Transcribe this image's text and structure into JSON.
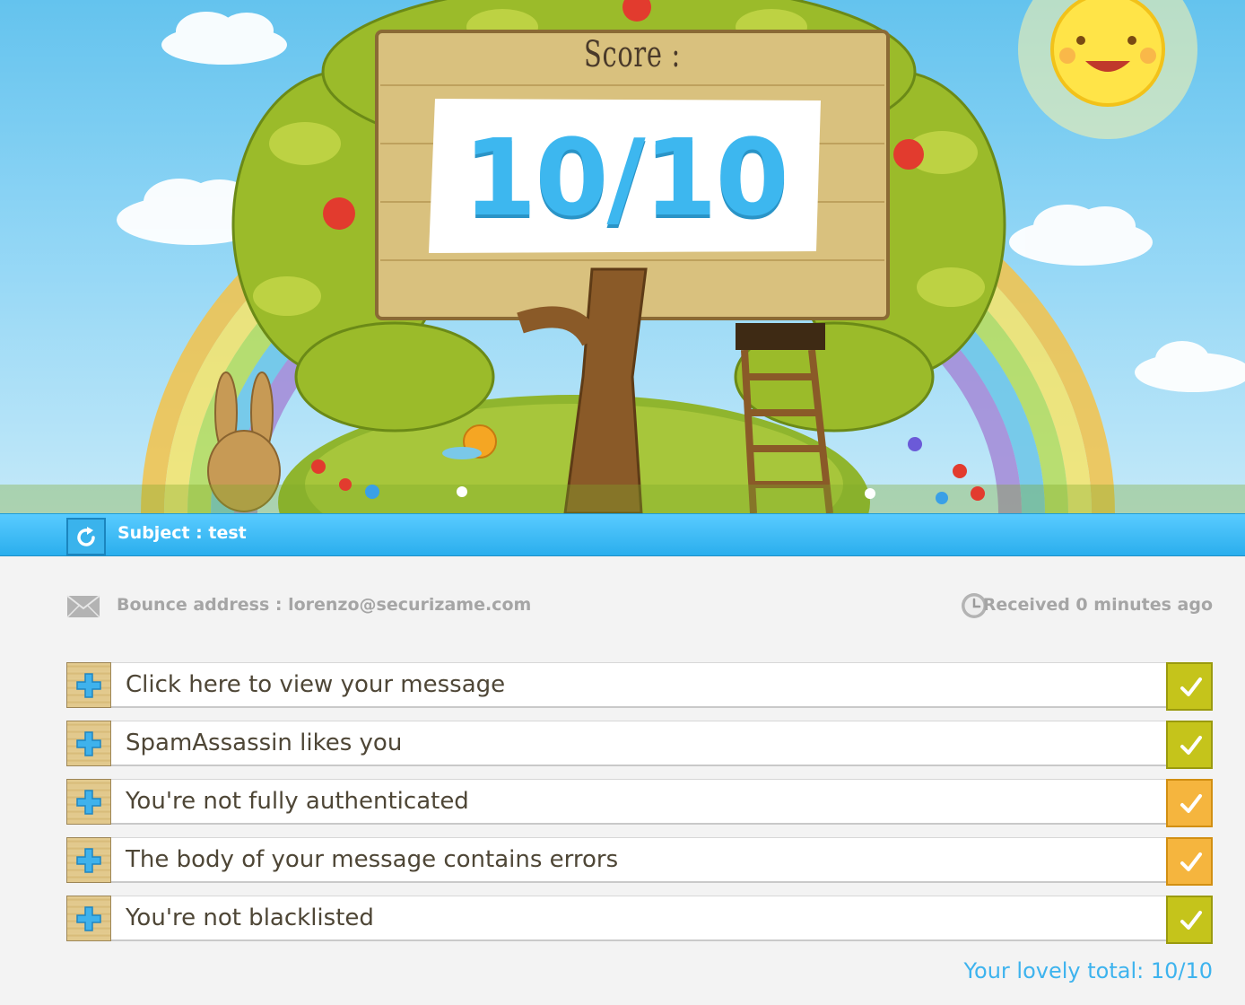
{
  "score": {
    "label": "Score :",
    "value": "10/10"
  },
  "subject": {
    "text": "Subject : test",
    "refresh_icon": "refresh-icon"
  },
  "meta": {
    "bounce": "Bounce address : lorenzo@securizame.com",
    "received": "Received 0 minutes ago",
    "mail_icon": "envelope-icon",
    "clock_icon": "clock-icon"
  },
  "checks": [
    {
      "label": "Click here to view your message",
      "status": "ok",
      "color": "#c5c41b"
    },
    {
      "label": "SpamAssassin likes you",
      "status": "ok",
      "color": "#c5c41b"
    },
    {
      "label": "You're not fully authenticated",
      "status": "warning",
      "color": "#f5b53e"
    },
    {
      "label": "The body of your message contains errors",
      "status": "warning",
      "color": "#f5b53e"
    },
    {
      "label": "You're not blacklisted",
      "status": "ok",
      "color": "#c5c41b"
    }
  ],
  "total": "Your lovely total: 10/10",
  "colors": {
    "accent": "#3db3ee",
    "ok": "#c5c41b",
    "warning": "#f5b53e"
  }
}
